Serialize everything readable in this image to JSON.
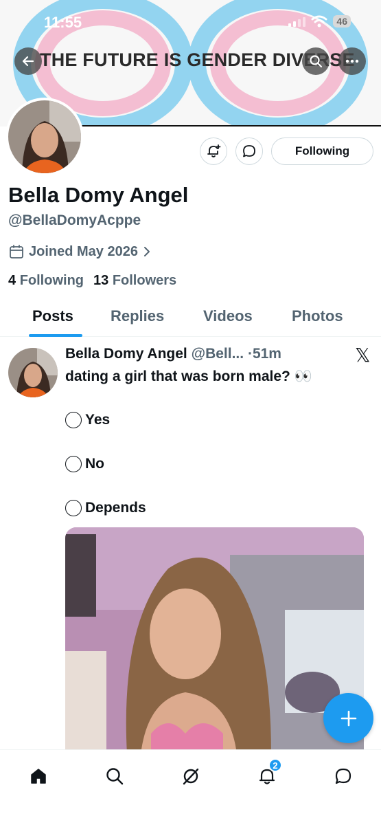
{
  "status_bar": {
    "time": "11:55",
    "battery": "46"
  },
  "banner": {
    "text": "THE FUTURE IS GENDER DIVERSE"
  },
  "profile": {
    "display_name": "Bella Domy Angel",
    "handle": "@BellaDomyAcppe",
    "joined": "Joined May 2026",
    "following_count": "4",
    "following_label": "Following",
    "followers_count": "13",
    "followers_label": "Followers",
    "following_button": "Following"
  },
  "tabs": [
    {
      "label": "Posts",
      "active": true
    },
    {
      "label": "Replies",
      "active": false
    },
    {
      "label": "Videos",
      "active": false
    },
    {
      "label": "Photos",
      "active": false
    }
  ],
  "post": {
    "author_name": "Bella Domy Angel",
    "author_handle": "@Bell...",
    "separator": "·",
    "time": "51m",
    "text": "dating a girl that was born male? 👀",
    "poll_options": [
      "Yes",
      "No",
      "Depends"
    ]
  },
  "bottom_nav": {
    "items": [
      "home-icon",
      "search-icon",
      "grok-icon",
      "notifications-icon",
      "messages-icon"
    ],
    "notification_badge": "2"
  },
  "colors": {
    "accent": "#1d9bf0",
    "text_primary": "#0f1419",
    "text_secondary": "#536471",
    "banner_pink": "#f0a8c4",
    "banner_blue": "#6ec3ea"
  }
}
